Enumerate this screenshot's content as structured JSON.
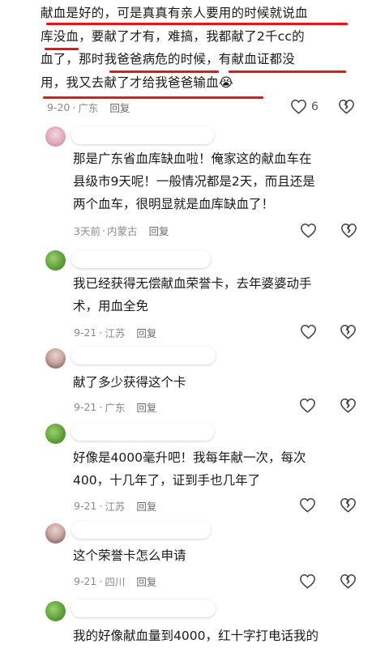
{
  "top_comment": {
    "lines": [
      "献血是好的，可是真真有亲人要用的时候就说血",
      "库没血，要献了才有，难搞，我都献了2千cc的",
      "血了，那时我爸爸病危的时候，有献血证都没",
      "用，我又去献了才给我爸爸输血😭"
    ],
    "date": "9-20",
    "location": "广东",
    "reply_label": "回复",
    "like_count": "6",
    "underline_color": "#e8141b"
  },
  "replies": [
    {
      "avatar": "pink",
      "lines": [
        "那是广东省血库缺血啦！俺家这的献血车在",
        "县级市9天呢！一般情况都是2天，而且还是",
        "两个血车，很明显就是血库缺血了！"
      ],
      "date": "3天前",
      "location": "内蒙古",
      "reply_label": "回复"
    },
    {
      "avatar": "green",
      "lines": [
        "我已经获得无偿献血荣誉卡，去年婆婆动手",
        "术，用血全免"
      ],
      "date": "9-21",
      "location": "江苏",
      "reply_label": "回复"
    },
    {
      "avatar": "photo",
      "lines": [
        "献了多少获得这个卡"
      ],
      "date": "9-21",
      "location": "广东",
      "reply_label": "回复"
    },
    {
      "avatar": "green",
      "lines": [
        "好像是4000毫升吧！我每年献一次，每次",
        "400，十几年了，证到手也几年了"
      ],
      "date": "9-21",
      "location": "江苏",
      "reply_label": "回复"
    },
    {
      "avatar": "photo",
      "lines": [
        "这个荣誉卡怎么申请"
      ],
      "date": "9-21",
      "location": "四川",
      "reply_label": "回复"
    },
    {
      "avatar": "green",
      "lines": [
        "我的好像献血量到4000，红十字打电话我的"
      ],
      "date": "",
      "location": "",
      "reply_label": ""
    }
  ]
}
